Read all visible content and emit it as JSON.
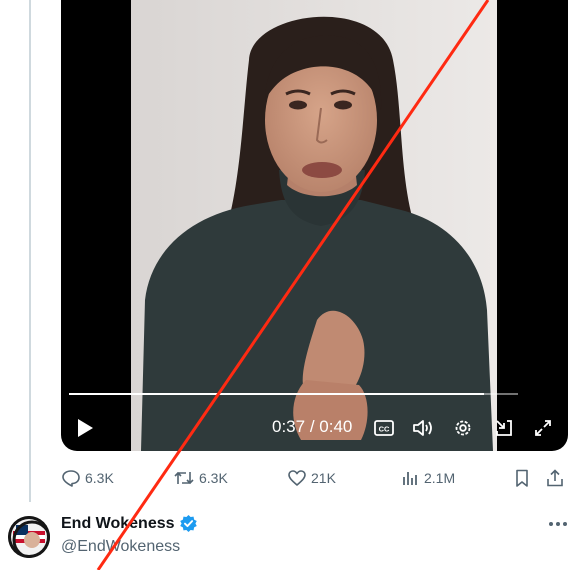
{
  "video": {
    "current_time": "0:37",
    "separator": "/",
    "duration": "0:40",
    "progress": 0.925,
    "icons": [
      "play-icon",
      "captions-icon",
      "volume-icon",
      "settings-icon",
      "pip-icon",
      "fullscreen-icon"
    ]
  },
  "actions": {
    "replies": "6.3K",
    "reposts": "6.3K",
    "likes": "21K",
    "views": "2.1M"
  },
  "author": {
    "name": "End Wokeness",
    "handle": "@EndWokeness",
    "verified": true
  },
  "colors": {
    "muted_text": "#536471",
    "primary_text": "#0f1419",
    "verified_blue": "#1d9bf0",
    "strike_red": "#ff2a12",
    "video_bg": "#000000"
  }
}
